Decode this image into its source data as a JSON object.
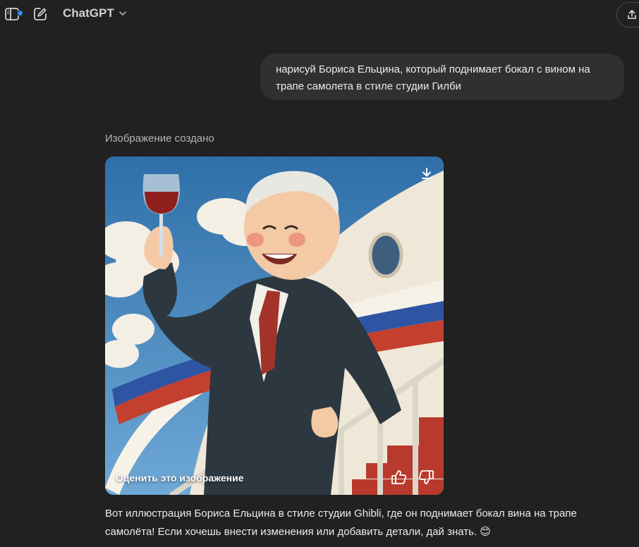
{
  "header": {
    "model_name": "ChatGPT",
    "icons": [
      "sidebar-toggle-icon",
      "new-chat-icon",
      "chevron-down-icon",
      "share-icon"
    ]
  },
  "conversation": {
    "user_message": "нарисуй Бориса Ельцина, который поднимает бокал с вином на трапе самолета в стиле студии Гилби",
    "image_status": "Изображение создано",
    "image_overlay": {
      "rate_label": "Оценить это изображение",
      "icons": [
        "download-icon",
        "thumbs-up-icon",
        "thumbs-down-icon"
      ]
    },
    "assistant_reply": "Вот иллюстрация Бориса Ельцина в стиле студии Ghibli, где он поднимает бокал вина на трапе самолёта! Если хочешь внести изменения или добавить детали, дай знать. 😊"
  },
  "colors": {
    "background": "#212121",
    "bubble": "#303030",
    "accent_dot": "#2f8cff"
  }
}
